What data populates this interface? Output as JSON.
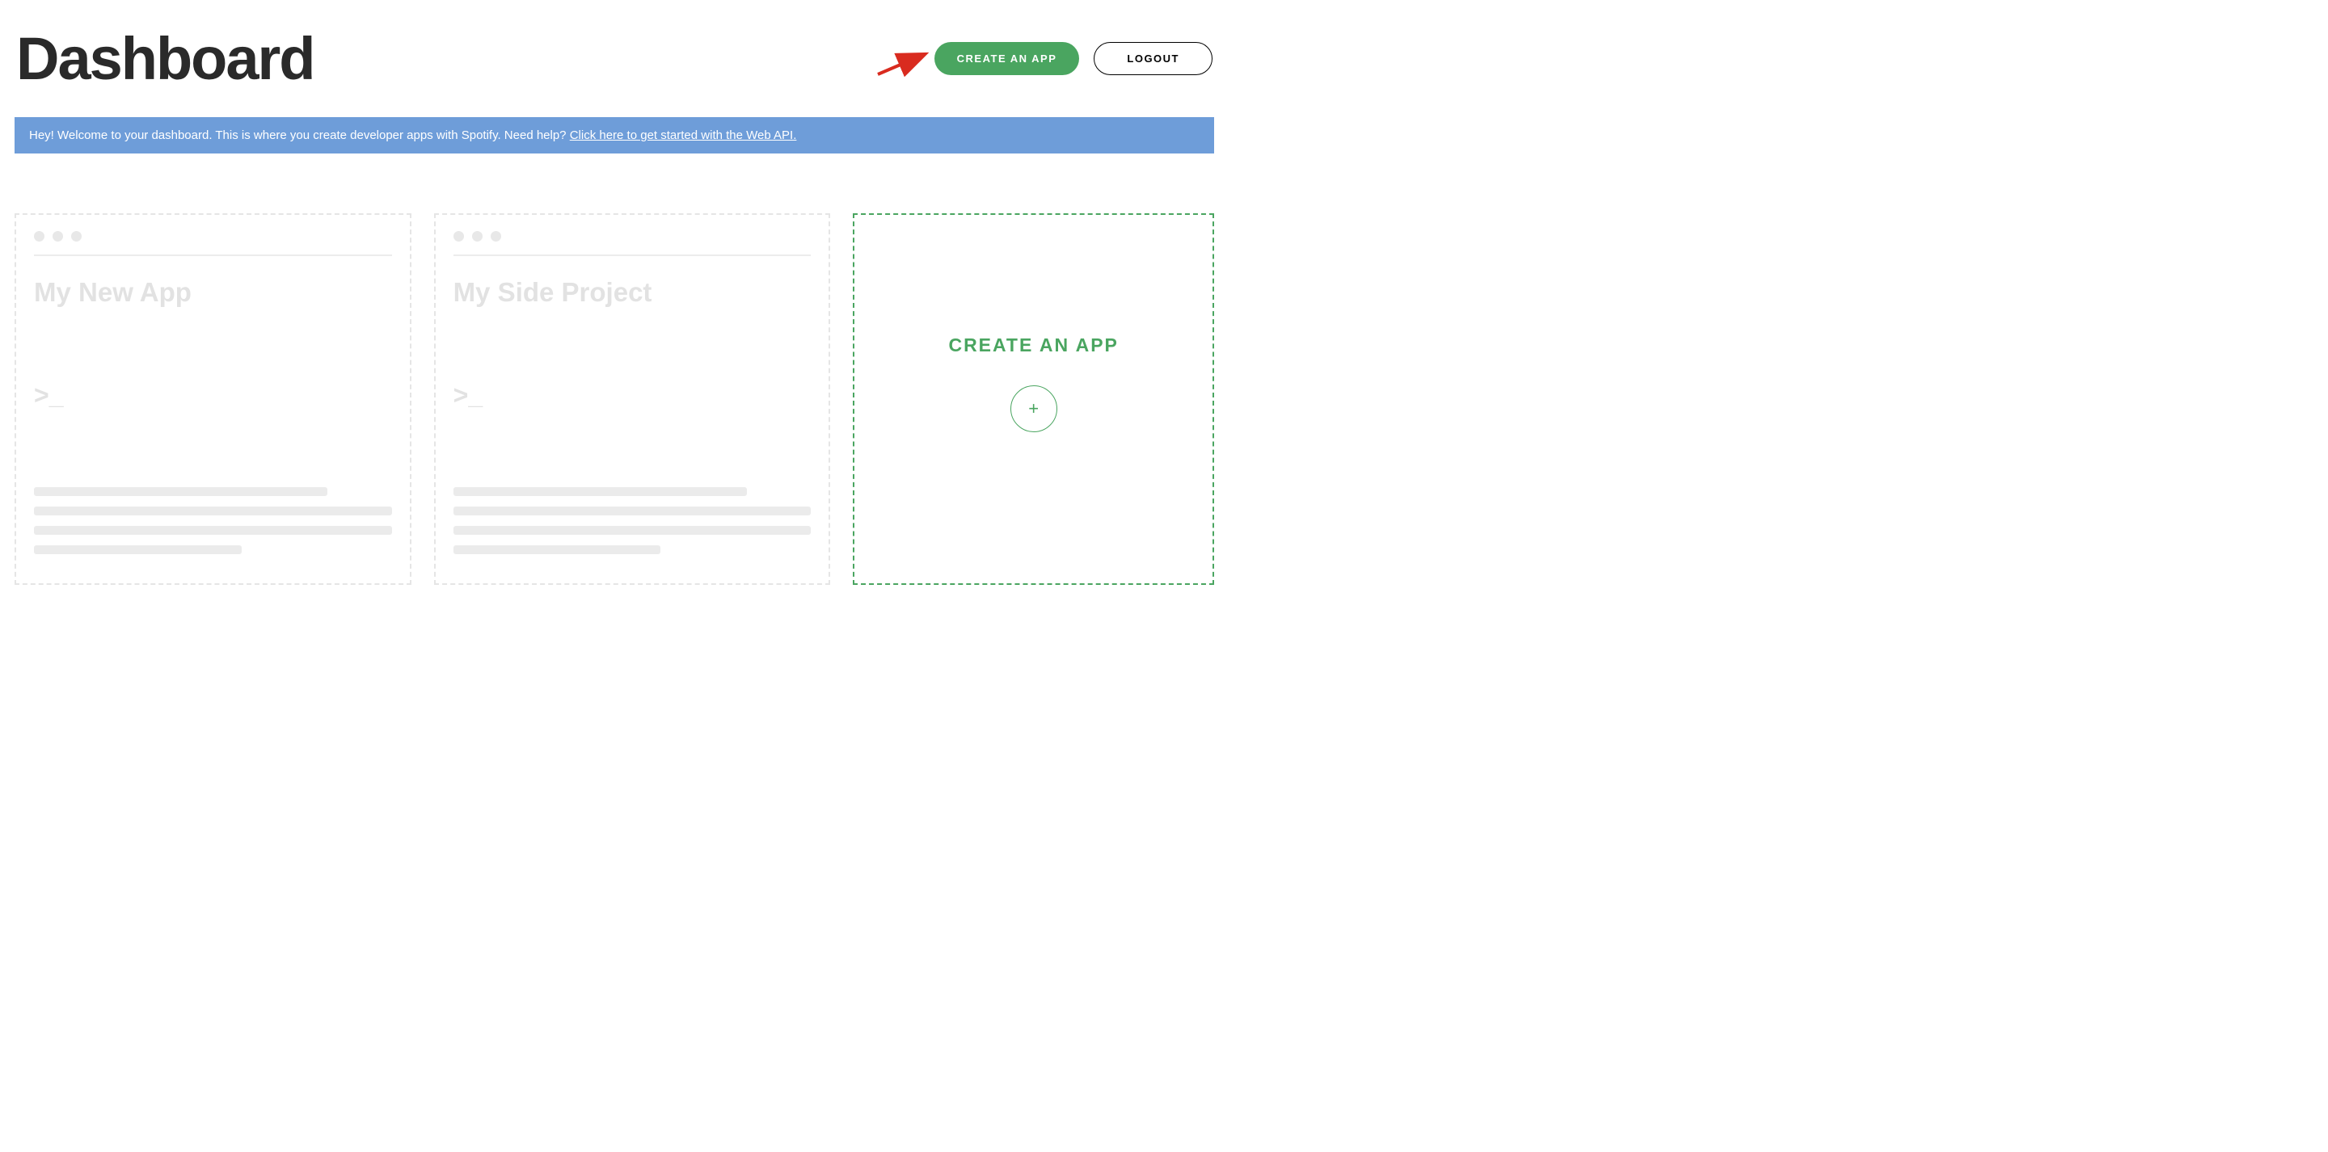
{
  "page": {
    "title": "Dashboard"
  },
  "header": {
    "create_app_label": "CREATE AN APP",
    "logout_label": "LOGOUT"
  },
  "banner": {
    "text_prefix": "Hey! Welcome to your dashboard. This is where you create developer apps with Spotify. Need help? ",
    "link_text": "Click here to get started with the Web API."
  },
  "cards": {
    "app_1": {
      "title": "My New App",
      "prompt": ">_"
    },
    "app_2": {
      "title": "My Side Project",
      "prompt": ">_"
    },
    "create": {
      "title": "CREATE AN APP",
      "plus": "+"
    }
  },
  "colors": {
    "primary_green": "#4aa560",
    "banner_blue": "#6e9dd9",
    "title_dark": "#2a2a2a",
    "placeholder_gray": "#e2e2e2"
  }
}
